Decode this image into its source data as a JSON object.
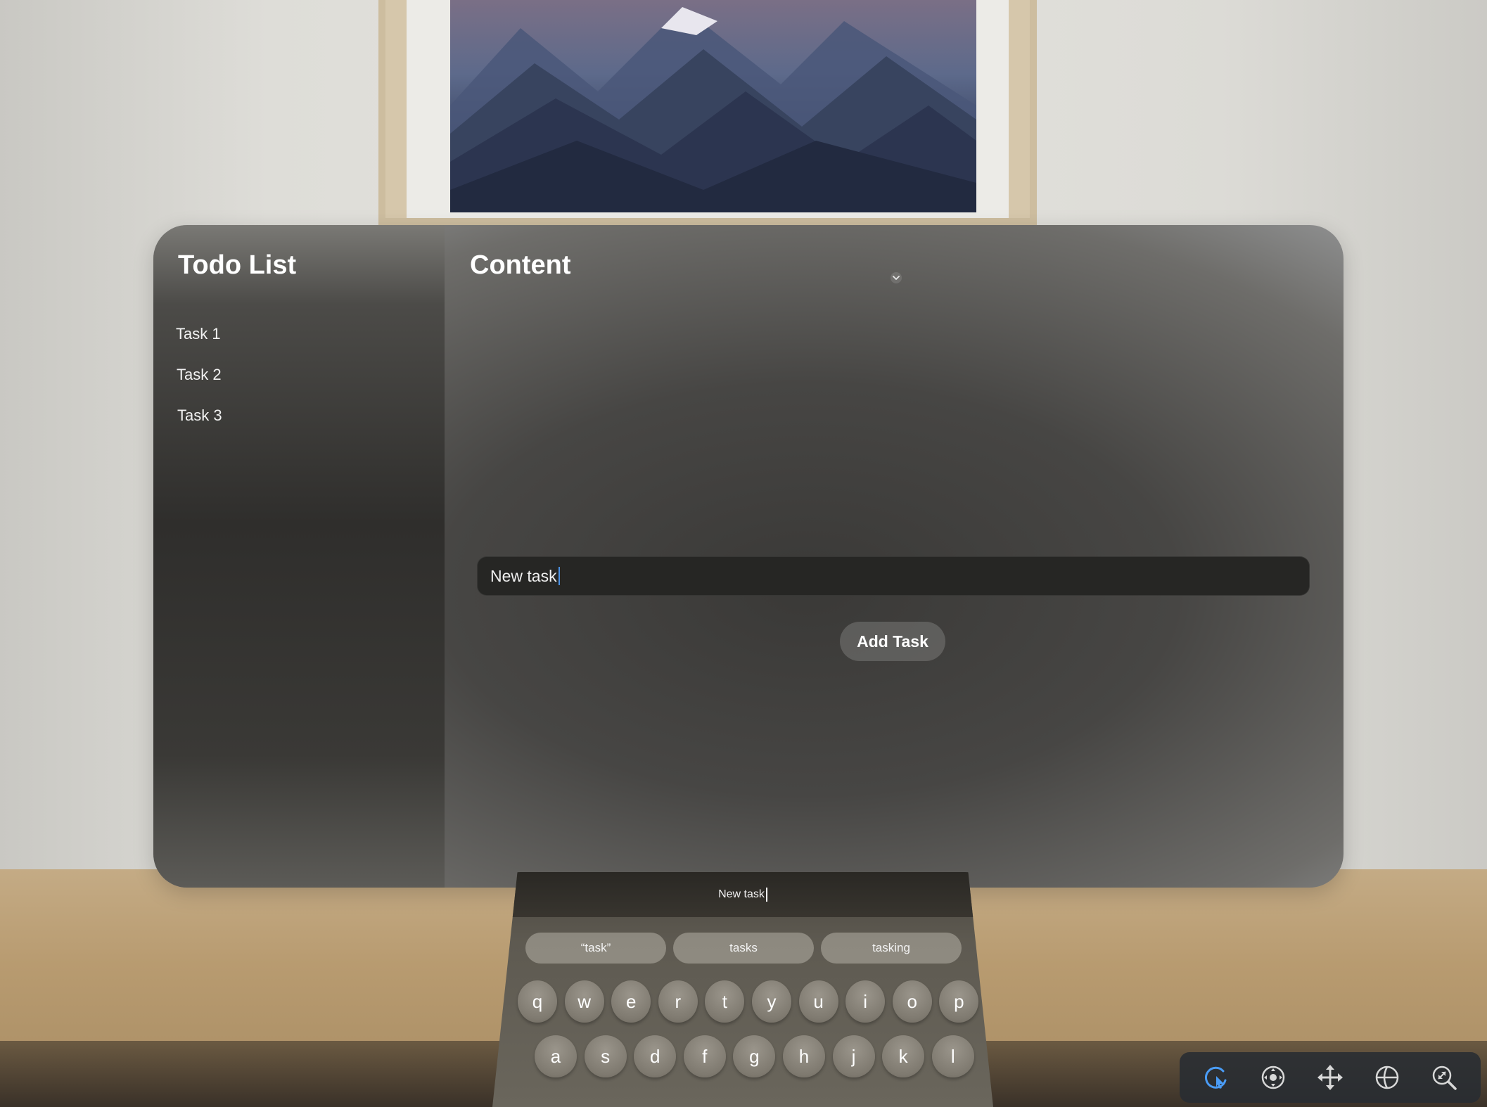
{
  "sidebar": {
    "title": "Todo List",
    "items": [
      {
        "label": "Task 1"
      },
      {
        "label": "Task 2"
      },
      {
        "label": "Task 3"
      }
    ]
  },
  "main": {
    "title": "Content",
    "input": {
      "value": "New task"
    },
    "add_button_label": "Add Task"
  },
  "keyboard": {
    "preview_text": "New task",
    "suggestions": [
      "“task”",
      "tasks",
      "tasking"
    ],
    "row1": [
      "q",
      "w",
      "e",
      "r",
      "t",
      "y",
      "u",
      "i",
      "o",
      "p"
    ],
    "row2": [
      "a",
      "s",
      "d",
      "f",
      "g",
      "h",
      "j",
      "k",
      "l"
    ]
  },
  "toolbar": {
    "tools": [
      {
        "icon": "pointer-icon",
        "active": true,
        "color": "#4a9cf6"
      },
      {
        "icon": "target-icon",
        "active": false
      },
      {
        "icon": "move-arrows-icon",
        "active": false
      },
      {
        "icon": "globe-icon",
        "active": false
      },
      {
        "icon": "zoom-icon",
        "active": false
      }
    ]
  },
  "colors": {
    "accent": "#4a9cf6",
    "window_dark": "#2f2e2c",
    "input_bg": "#262624"
  }
}
